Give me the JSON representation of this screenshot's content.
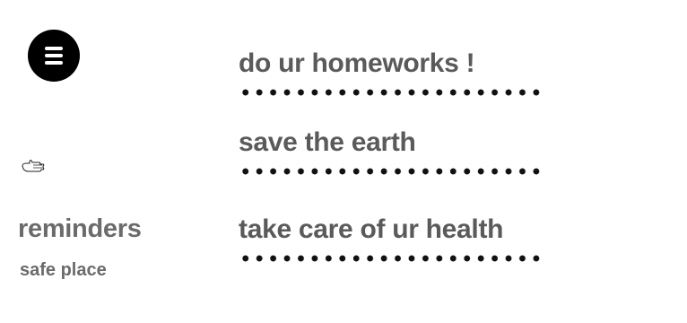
{
  "menu": {
    "icon": "hamburger-menu-icon"
  },
  "sidebar": {
    "icon": "pointing-hand-icon",
    "title": "reminders",
    "subtitle": "safe place"
  },
  "reminders": [
    {
      "text": "do ur homeworks !"
    },
    {
      "text": "save the earth"
    },
    {
      "text": "take care of ur health"
    }
  ]
}
